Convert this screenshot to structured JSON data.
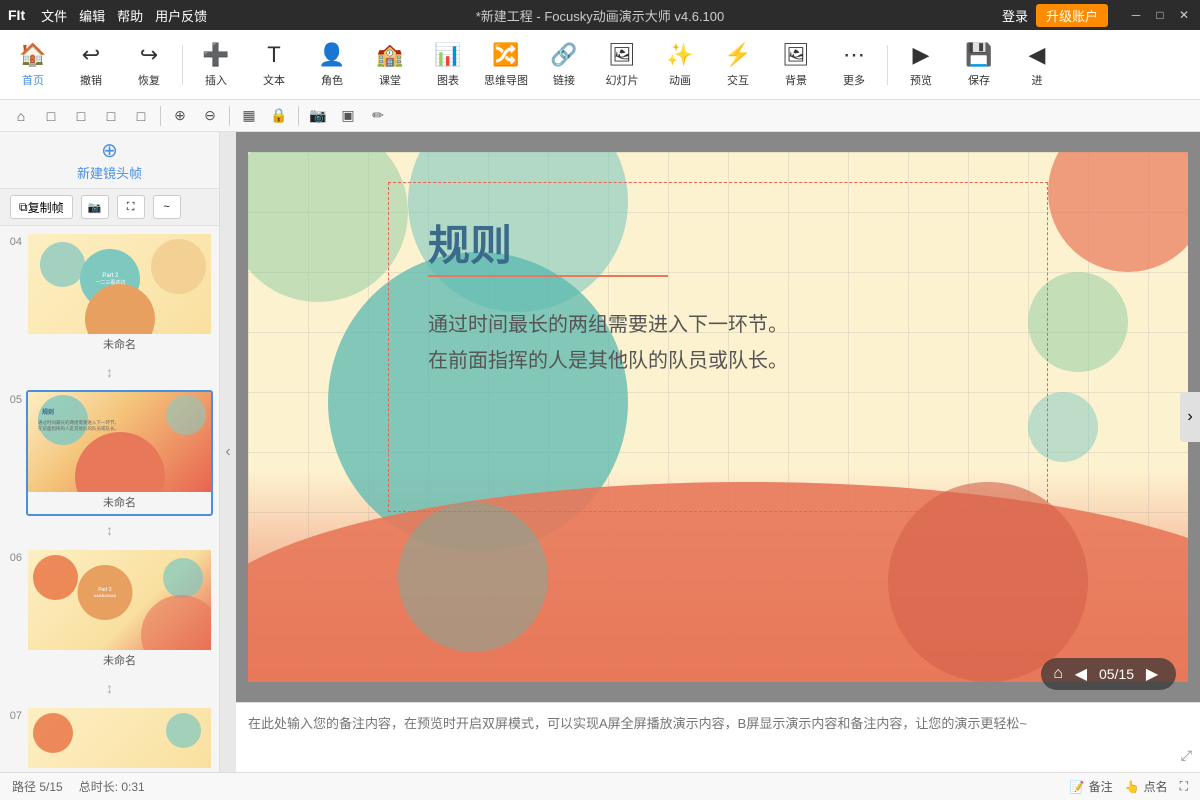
{
  "titlebar": {
    "app_name": "FIt",
    "title": "*新建工程 - Focusky动画演示大师  v4.6.100",
    "menu_items": [
      "文件",
      "编辑",
      "帮助",
      "用户反馈"
    ],
    "login_label": "登录",
    "upgrade_label": "升级账户"
  },
  "toolbar": {
    "items": [
      {
        "id": "home",
        "label": "首页",
        "icon": "🏠"
      },
      {
        "id": "undo",
        "label": "撤销",
        "icon": "↩"
      },
      {
        "id": "redo",
        "label": "恢复",
        "icon": "↪"
      },
      {
        "id": "insert",
        "label": "插入",
        "icon": "➕"
      },
      {
        "id": "text",
        "label": "文本",
        "icon": "📝"
      },
      {
        "id": "role",
        "label": "角色",
        "icon": "👤"
      },
      {
        "id": "class",
        "label": "课堂",
        "icon": "🏫"
      },
      {
        "id": "chart",
        "label": "图表",
        "icon": "📊"
      },
      {
        "id": "mindmap",
        "label": "思维导图",
        "icon": "🔀"
      },
      {
        "id": "link",
        "label": "链接",
        "icon": "🔗"
      },
      {
        "id": "slides",
        "label": "幻灯片",
        "icon": "🖼"
      },
      {
        "id": "animation",
        "label": "动画",
        "icon": "🎬"
      },
      {
        "id": "interact",
        "label": "交互",
        "icon": "🤝"
      },
      {
        "id": "bg",
        "label": "背景",
        "icon": "🖼"
      },
      {
        "id": "more",
        "label": "更多",
        "icon": "···"
      },
      {
        "id": "preview",
        "label": "预览",
        "icon": "▶"
      },
      {
        "id": "save",
        "label": "保存",
        "icon": "💾"
      },
      {
        "id": "nav",
        "label": "进",
        "icon": "◀"
      }
    ]
  },
  "iconbar": {
    "buttons": [
      "⌂",
      "□",
      "□",
      "□",
      "□",
      "⊕",
      "⊖",
      "▤",
      "🔒",
      "📷",
      "▣",
      "✏"
    ]
  },
  "slidepanel": {
    "new_frame_label": "新建镜头帧",
    "frame_tools": [
      "复制帧",
      "📷",
      "⛶",
      "~"
    ],
    "slides": [
      {
        "number": "04",
        "label": "未命名",
        "active": false
      },
      {
        "number": "05",
        "label": "未命名",
        "active": true
      },
      {
        "number": "06",
        "label": "未命名",
        "active": false
      },
      {
        "number": "07",
        "label": "",
        "active": false
      }
    ]
  },
  "canvas": {
    "slide_title": "规则",
    "slide_body_line1": "通过时间最长的两组需要进入下一环节。",
    "slide_body_line2": "在前面指挥的人是其他队的队员或队长。"
  },
  "navigation": {
    "home_icon": "⌂",
    "prev_icon": "◀",
    "page_info": "05/15",
    "next_icon": "▶"
  },
  "notes": {
    "placeholder": "在此处输入您的备注内容，在预览时开启双屏模式，可以实现A屏全屏播放演示内容，B屏显示演示内容和备注内容，让您的演示更轻松~"
  },
  "statusbar": {
    "page_info": "路径 5/15",
    "duration": "总时长: 0:31",
    "notes_label": "备注",
    "pointname_label": "点名"
  }
}
